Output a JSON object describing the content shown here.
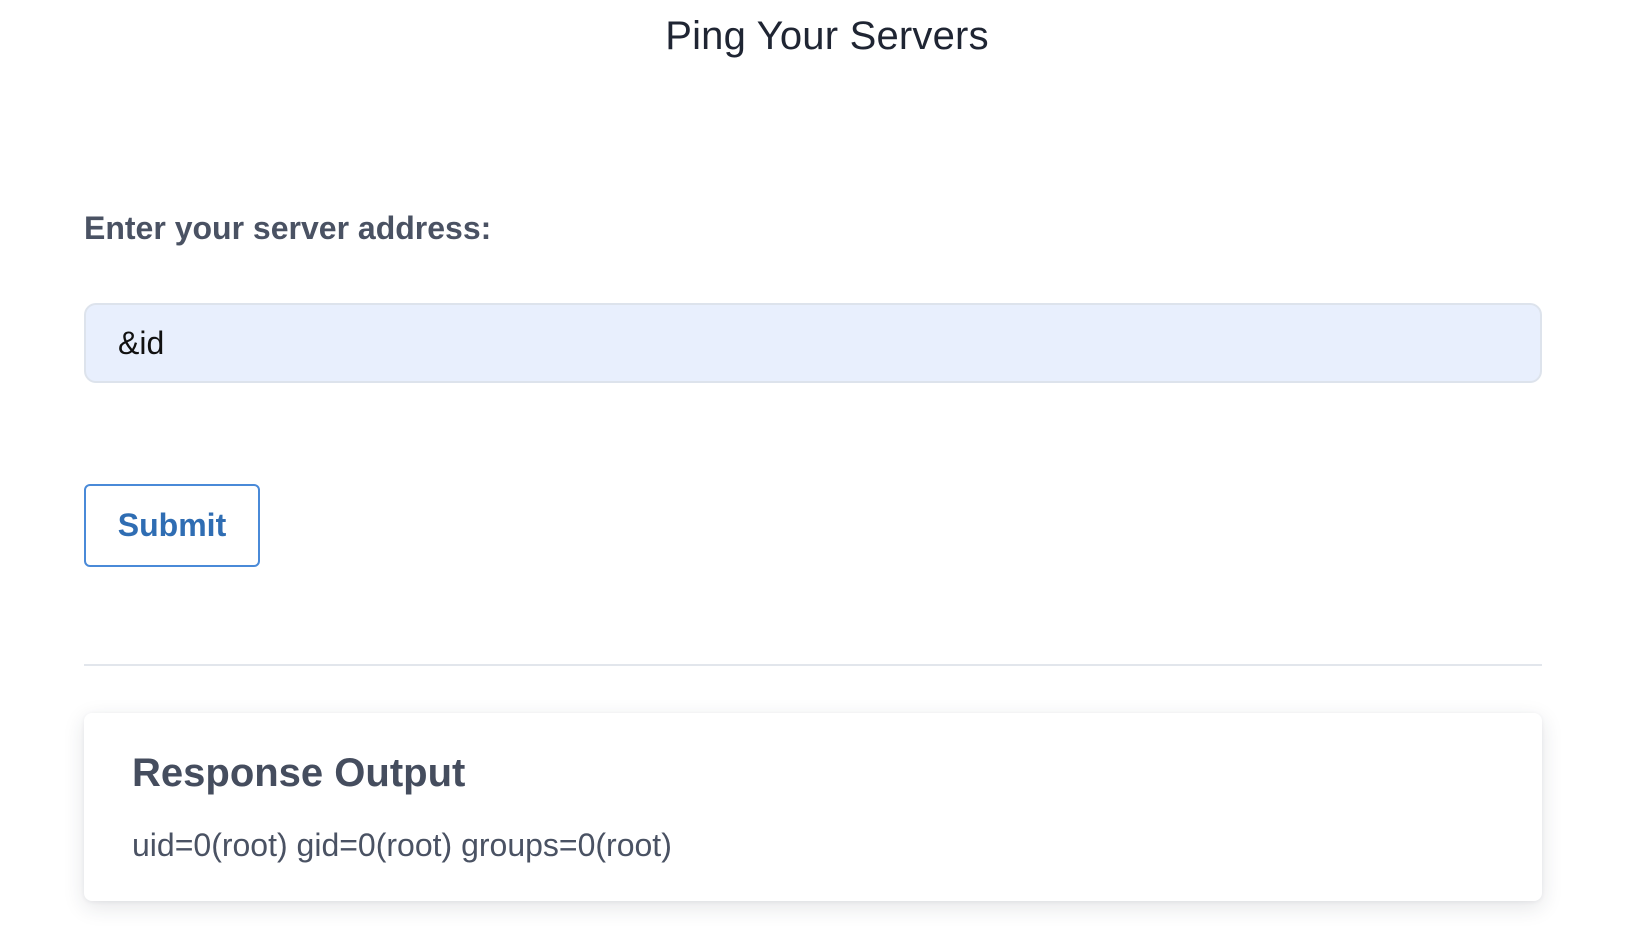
{
  "header": {
    "title": "Ping Your Servers"
  },
  "form": {
    "label": "Enter your server address:",
    "input_value": "&id",
    "submit_label": "Submit"
  },
  "response": {
    "title": "Response Output",
    "output": "uid=0(root) gid=0(root) groups=0(root)"
  },
  "colors": {
    "input_background": "#e8effd",
    "button_accent": "#2f6db3",
    "button_border": "#4a8ad8",
    "heading_text": "#1f2533",
    "body_text": "#4a5263"
  }
}
